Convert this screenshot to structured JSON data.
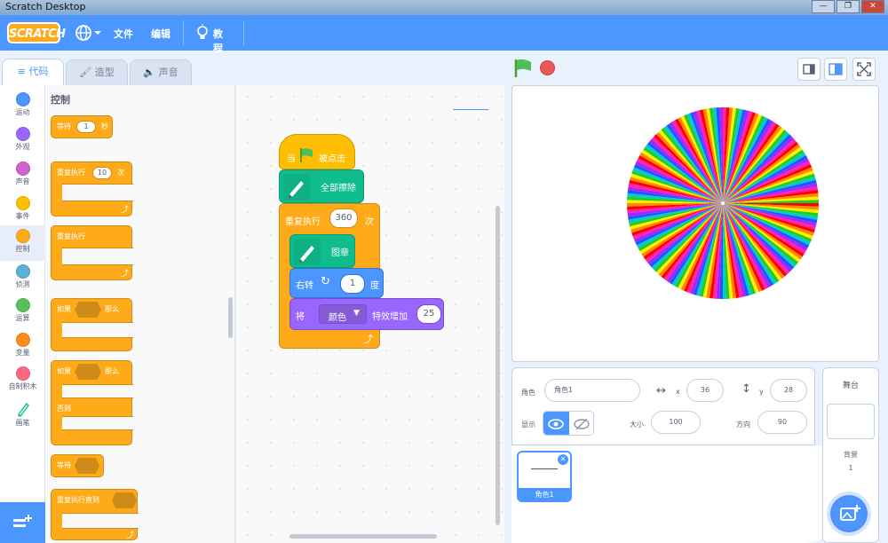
{
  "window": {
    "title": "Scratch Desktop",
    "ctrl_min": "—",
    "ctrl_max": "❐",
    "ctrl_close": "✕"
  },
  "menu": {
    "logo": "SCRATCH",
    "file": "文件",
    "edit": "编辑",
    "tutorials": "教程"
  },
  "tabs": {
    "code": "代码",
    "costumes": "造型",
    "sounds": "声音"
  },
  "categories": [
    {
      "label": "运动",
      "color": "#4c97ff"
    },
    {
      "label": "外观",
      "color": "#9966ff"
    },
    {
      "label": "声音",
      "color": "#cf63cf"
    },
    {
      "label": "事件",
      "color": "#ffbf00"
    },
    {
      "label": "控制",
      "color": "#ffab19"
    },
    {
      "label": "侦测",
      "color": "#5cb1d6"
    },
    {
      "label": "运算",
      "color": "#59c059"
    },
    {
      "label": "变量",
      "color": "#ff8c1a"
    },
    {
      "label": "自制积木",
      "color": "#ff6680"
    },
    {
      "label": "画笔",
      "color": "#0fbd8c"
    }
  ],
  "palette": {
    "heading": "控制",
    "wait": {
      "pre": "等待",
      "val": "1",
      "post": "秒"
    },
    "repeat": {
      "pre": "重复执行",
      "val": "10",
      "post": "次"
    },
    "forever": "重复执行",
    "if_then": {
      "pre": "如果",
      "post": "那么"
    },
    "if_else": {
      "pre": "如果",
      "post": "那么",
      "else": "否则"
    },
    "wait_until": "等待",
    "repeat_until": "重复执行直到"
  },
  "script": {
    "hat": {
      "pre": "当",
      "post": "被点击"
    },
    "clear": "全部擦除",
    "repeat": {
      "pre": "重复执行",
      "val": "360",
      "post": "次"
    },
    "stamp": "图章",
    "turn": {
      "pre": "右转",
      "val": "1",
      "post": "度"
    },
    "effect": {
      "pre": "将",
      "dropdown": "颜色",
      "mid": "特效增加",
      "val": "25"
    }
  },
  "zoom": {
    "in": "+",
    "out": "−",
    "reset": "="
  },
  "sprite_info": {
    "sprite_label": "角色",
    "sprite_name": "角色1",
    "x_label": "x",
    "x": "36",
    "y_label": "y",
    "y": "28",
    "show_label": "显示",
    "size_label": "大小",
    "size": "100",
    "direction_label": "方向",
    "direction": "90"
  },
  "sprites": [
    {
      "name": "角色1"
    }
  ],
  "stage_panel": {
    "title": "舞台",
    "backdrops_label": "背景",
    "backdrops_count": "1"
  },
  "colors": {
    "accent": "#4c97ff",
    "control": "#ffab19",
    "pen": "#0fbd8c",
    "looks": "#9966ff",
    "event": "#ffbf00"
  }
}
